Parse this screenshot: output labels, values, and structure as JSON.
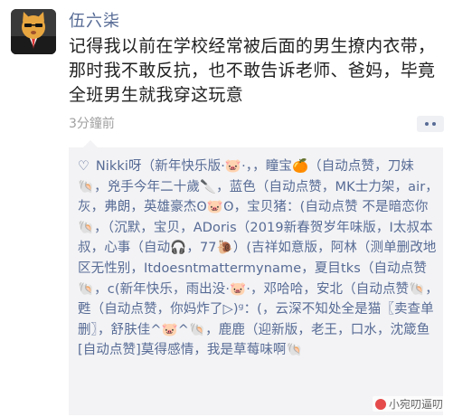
{
  "post": {
    "username": "伍六柒",
    "text": "记得我以前在学校经常被后面的男生撩内衣带，那时我不敢反抗，也不敢告诉老师、爸妈，毕竟全班男生就我穿这玩意",
    "time": "3分鐘前"
  },
  "likes": {
    "heart_icon": "heart-icon",
    "text": "Nikki呀（新年快乐版·🐷·，，瞳宝🍊（自动点赞，刀妹🐚，兇手今年二十歲🔪，蓝色（自动点赞，MK士力架，air，灰，弗朗，英雄豪杰ʘ🐷ʘ，宝贝猪：(自动点赞 不是暗恋你🐚，（沉默，宝贝，ADoris（2019新春贺岁年味版，Ⅰ太叔本叔，心事（自动🎧，77🐌）(吉祥如意版，阿林（测单删改地区无性别，Itdoesntmattermyname，夏目tks（自动点赞🐚，c(新年快乐，雨出没·🐷·，邓哈哈，安北（自动点赞🐚，甦（自动点赞，你妈炸了▷)ᵍ：(，云深不知处全是猫〖卖查单删〗，舒肤佳^🐷^🐚，鹿鹿（迎新版，老王，口水，沈箴鱼[自动点赞]莫得感情，我是草莓味啊🐚"
  },
  "watermark": {
    "text": "小宛叨逼叨",
    "icon": "brand-logo-icon"
  },
  "colors": {
    "link": "#576b95",
    "likes_bg": "#f3f3f5",
    "time": "#a0a0a0"
  }
}
